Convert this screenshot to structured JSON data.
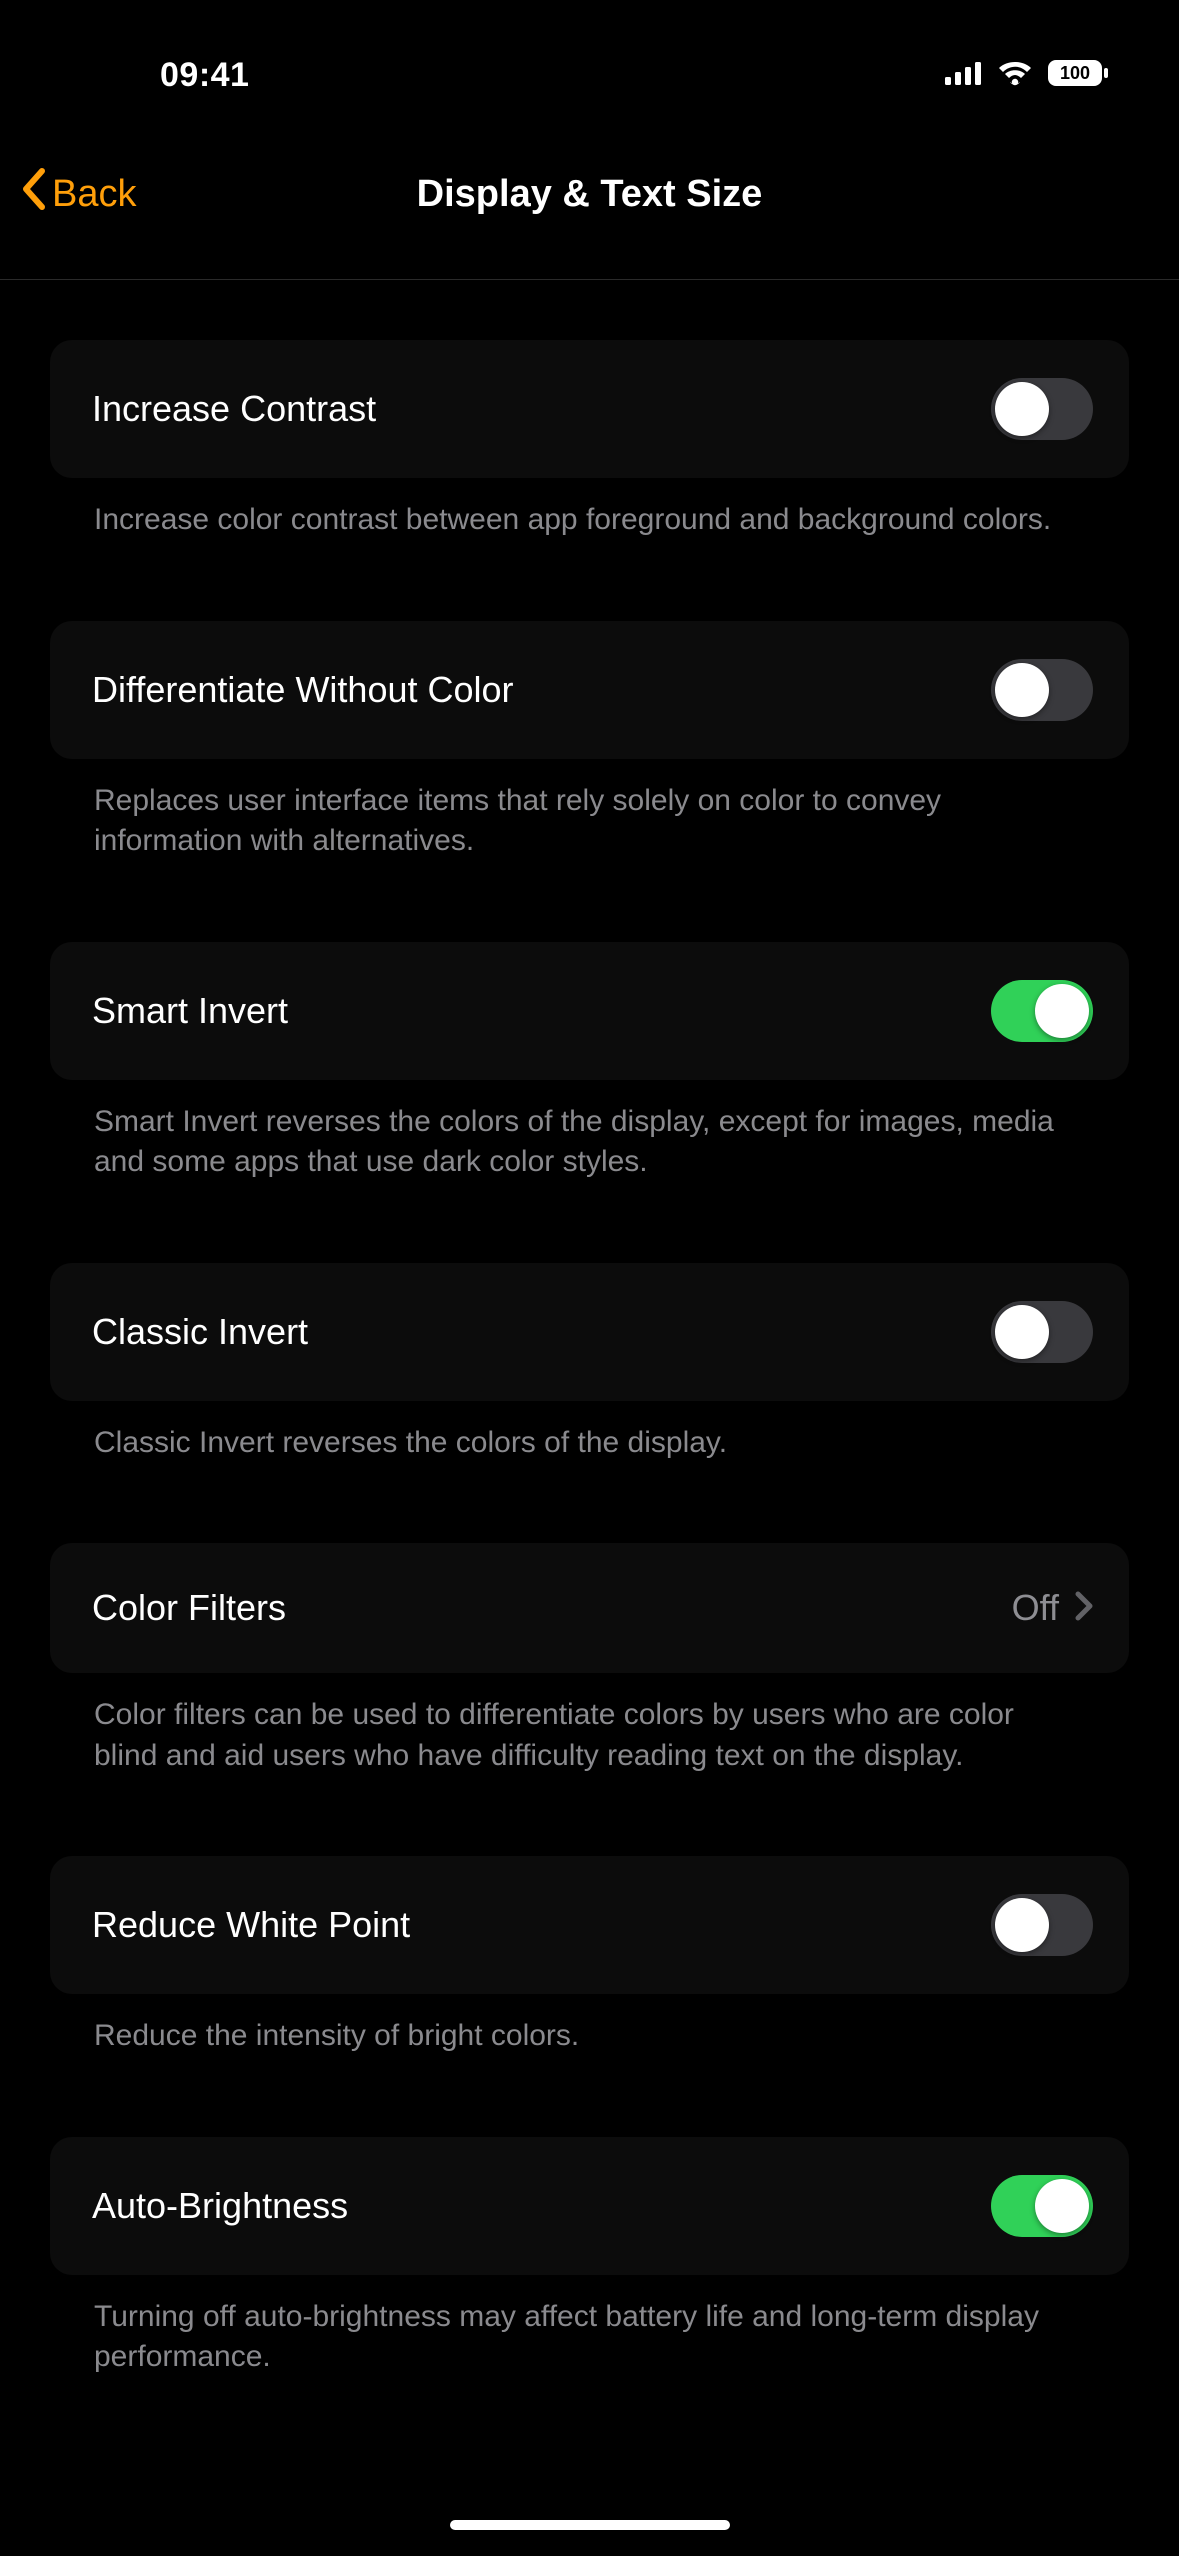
{
  "statusBar": {
    "time": "09:41",
    "battery": "100"
  },
  "nav": {
    "back": "Back",
    "title": "Display & Text Size"
  },
  "settings": [
    {
      "id": "increase-contrast",
      "label": "Increase Contrast",
      "type": "toggle",
      "value": false,
      "footer": "Increase color contrast between app foreground and background colors."
    },
    {
      "id": "differentiate-without-color",
      "label": "Differentiate Without Color",
      "type": "toggle",
      "value": false,
      "footer": "Replaces user interface items that rely solely on color to convey information with alternatives."
    },
    {
      "id": "smart-invert",
      "label": "Smart Invert",
      "type": "toggle",
      "value": true,
      "footer": "Smart Invert reverses the colors of the display, except for images, media and some apps that use dark color styles."
    },
    {
      "id": "classic-invert",
      "label": "Classic Invert",
      "type": "toggle",
      "value": false,
      "footer": "Classic Invert reverses the colors of the display."
    },
    {
      "id": "color-filters",
      "label": "Color Filters",
      "type": "link",
      "detail": "Off",
      "footer": "Color filters can be used to differentiate colors by users who are color blind and aid users who have difficulty reading text on the display."
    },
    {
      "id": "reduce-white-point",
      "label": "Reduce White Point",
      "type": "toggle",
      "value": false,
      "footer": "Reduce the intensity of bright colors."
    },
    {
      "id": "auto-brightness",
      "label": "Auto-Brightness",
      "type": "toggle",
      "value": true,
      "footer": "Turning off auto-brightness may affect battery life and long-term display performance."
    }
  ]
}
